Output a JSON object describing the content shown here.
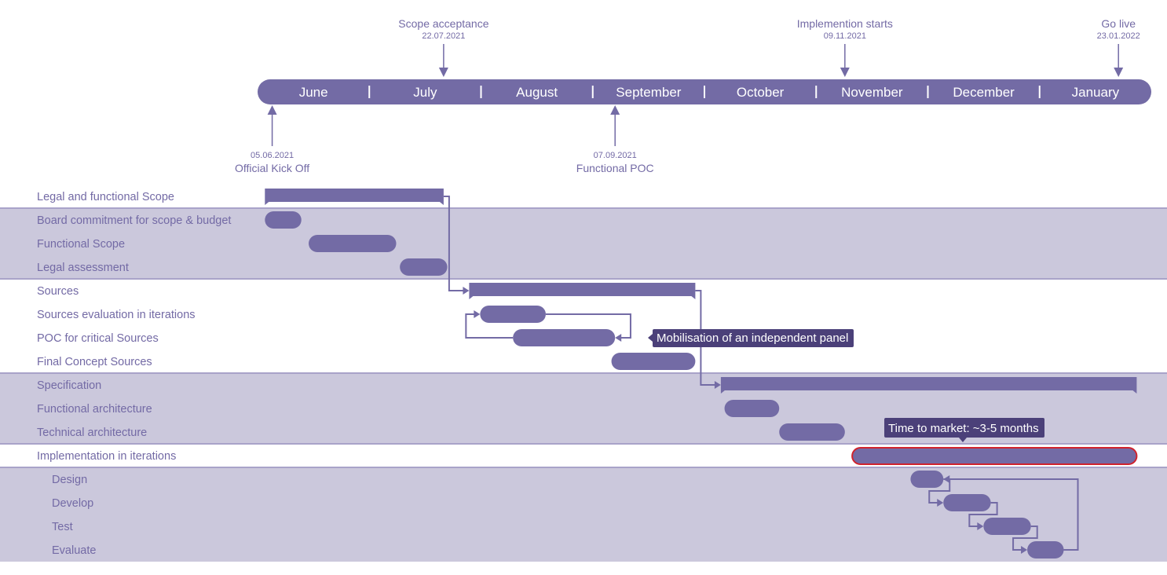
{
  "chart_data": {
    "type": "gantt",
    "title": "",
    "timeline": {
      "start": "2021-06-01",
      "end": "2022-02-01",
      "months": [
        "June",
        "July",
        "August",
        "September",
        "October",
        "November",
        "December",
        "January"
      ]
    },
    "milestones": [
      {
        "name": "Scope acceptance",
        "date": "22.07.2021",
        "iso": "2021-07-22",
        "position": "above"
      },
      {
        "name": "Implemention starts",
        "date": "09.11.2021",
        "iso": "2021-11-09",
        "position": "above"
      },
      {
        "name": "Go live",
        "date": "23.01.2022",
        "iso": "2022-01-23",
        "position": "above"
      },
      {
        "name": "Official Kick Off",
        "date": "05.06.2021",
        "iso": "2021-06-05",
        "position": "below"
      },
      {
        "name": "Functional POC",
        "date": "07.09.2021",
        "iso": "2021-09-07",
        "position": "below"
      }
    ],
    "tasks": [
      {
        "label": "Legal and functional Scope",
        "start": "2021-06-03",
        "end": "2021-07-22",
        "kind": "summary",
        "band": false,
        "indent": 0
      },
      {
        "label": "Board commitment for scope & budget",
        "start": "2021-06-03",
        "end": "2021-06-13",
        "kind": "task",
        "band": true,
        "indent": 0
      },
      {
        "label": "Functional Scope",
        "start": "2021-06-15",
        "end": "2021-07-09",
        "kind": "task",
        "band": true,
        "indent": 0
      },
      {
        "label": "Legal assessment",
        "start": "2021-07-10",
        "end": "2021-07-23",
        "kind": "task",
        "band": true,
        "indent": 0
      },
      {
        "label": "Sources",
        "start": "2021-07-29",
        "end": "2021-09-29",
        "kind": "summary",
        "band": false,
        "indent": 0
      },
      {
        "label": "Sources evaluation in iterations",
        "start": "2021-08-01",
        "end": "2021-08-19",
        "kind": "task",
        "band": false,
        "indent": 0
      },
      {
        "label": "POC for critical Sources",
        "start": "2021-08-10",
        "end": "2021-09-07",
        "kind": "task",
        "band": false,
        "indent": 0
      },
      {
        "label": "Final Concept Sources",
        "start": "2021-09-06",
        "end": "2021-09-29",
        "kind": "task",
        "band": false,
        "indent": 0
      },
      {
        "label": "Specification",
        "start": "2021-10-06",
        "end": "2022-01-28",
        "kind": "summary",
        "band": true,
        "indent": 0
      },
      {
        "label": "Functional architecture",
        "start": "2021-10-07",
        "end": "2021-10-22",
        "kind": "task",
        "band": true,
        "indent": 0
      },
      {
        "label": "Technical architecture",
        "start": "2021-10-22",
        "end": "2021-11-09",
        "kind": "task",
        "band": true,
        "indent": 0
      },
      {
        "label": "Implementation in iterations",
        "start": "2021-11-11",
        "end": "2022-01-28",
        "kind": "highlight",
        "band": false,
        "indent": 0
      },
      {
        "label": "Design",
        "start": "2021-11-27",
        "end": "2021-12-06",
        "kind": "task",
        "band": true,
        "indent": 1
      },
      {
        "label": "Develop",
        "start": "2021-12-06",
        "end": "2021-12-19",
        "kind": "task",
        "band": true,
        "indent": 1
      },
      {
        "label": "Test",
        "start": "2021-12-17",
        "end": "2021-12-30",
        "kind": "task",
        "band": true,
        "indent": 1
      },
      {
        "label": "Evaluate",
        "start": "2021-12-29",
        "end": "2022-01-08",
        "kind": "task",
        "band": true,
        "indent": 1
      }
    ],
    "dependencies": [
      {
        "from": 0,
        "to": 4,
        "type": "finish-start"
      },
      {
        "from": 4,
        "to": 8,
        "type": "finish-start"
      },
      {
        "from": 5,
        "to": 6,
        "type": "loop"
      },
      {
        "from": 6,
        "to": 5,
        "type": "loop"
      },
      {
        "from": 12,
        "to": 13,
        "type": "finish-start"
      },
      {
        "from": 13,
        "to": 14,
        "type": "finish-start"
      },
      {
        "from": 14,
        "to": 15,
        "type": "finish-start"
      },
      {
        "from": 15,
        "to": 12,
        "type": "loop"
      }
    ],
    "callouts": [
      {
        "text": "Mobilisation of an independent panel",
        "task": 6,
        "pointer": "left"
      },
      {
        "text": "Time to market: ~3-5 months",
        "task": 11,
        "pointer": "down"
      }
    ]
  },
  "colors": {
    "bar": "#736ba5",
    "band": "#cbc8dc",
    "band_line": "#a9a3c9",
    "text": "#736aa5",
    "callout_bg": "#4b4079",
    "highlight_border": "#d0232d",
    "background": "#ffffff"
  }
}
